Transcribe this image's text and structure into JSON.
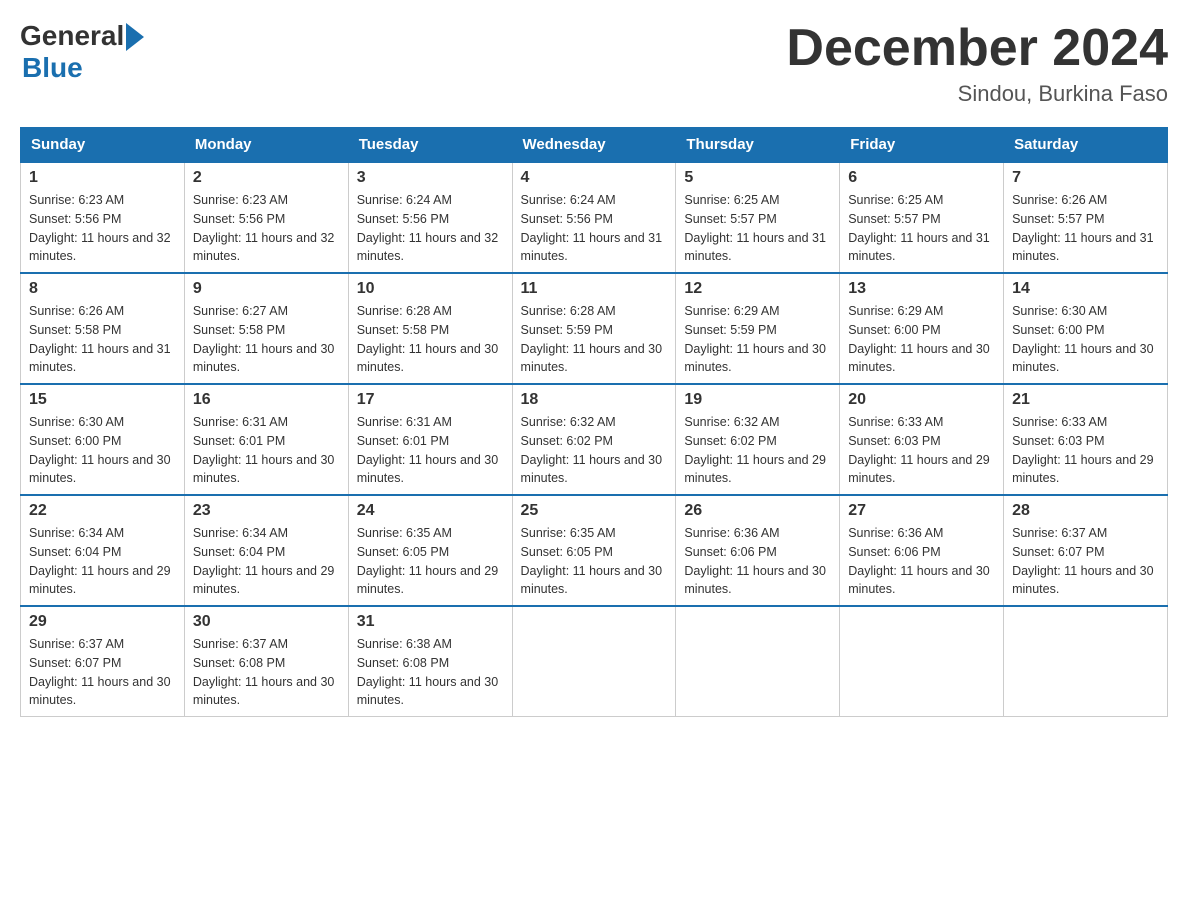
{
  "logo": {
    "general": "General",
    "blue": "Blue"
  },
  "title": {
    "month_year": "December 2024",
    "location": "Sindou, Burkina Faso"
  },
  "days_of_week": [
    "Sunday",
    "Monday",
    "Tuesday",
    "Wednesday",
    "Thursday",
    "Friday",
    "Saturday"
  ],
  "weeks": [
    [
      {
        "day": "1",
        "sunrise": "6:23 AM",
        "sunset": "5:56 PM",
        "daylight": "11 hours and 32 minutes."
      },
      {
        "day": "2",
        "sunrise": "6:23 AM",
        "sunset": "5:56 PM",
        "daylight": "11 hours and 32 minutes."
      },
      {
        "day": "3",
        "sunrise": "6:24 AM",
        "sunset": "5:56 PM",
        "daylight": "11 hours and 32 minutes."
      },
      {
        "day": "4",
        "sunrise": "6:24 AM",
        "sunset": "5:56 PM",
        "daylight": "11 hours and 31 minutes."
      },
      {
        "day": "5",
        "sunrise": "6:25 AM",
        "sunset": "5:57 PM",
        "daylight": "11 hours and 31 minutes."
      },
      {
        "day": "6",
        "sunrise": "6:25 AM",
        "sunset": "5:57 PM",
        "daylight": "11 hours and 31 minutes."
      },
      {
        "day": "7",
        "sunrise": "6:26 AM",
        "sunset": "5:57 PM",
        "daylight": "11 hours and 31 minutes."
      }
    ],
    [
      {
        "day": "8",
        "sunrise": "6:26 AM",
        "sunset": "5:58 PM",
        "daylight": "11 hours and 31 minutes."
      },
      {
        "day": "9",
        "sunrise": "6:27 AM",
        "sunset": "5:58 PM",
        "daylight": "11 hours and 30 minutes."
      },
      {
        "day": "10",
        "sunrise": "6:28 AM",
        "sunset": "5:58 PM",
        "daylight": "11 hours and 30 minutes."
      },
      {
        "day": "11",
        "sunrise": "6:28 AM",
        "sunset": "5:59 PM",
        "daylight": "11 hours and 30 minutes."
      },
      {
        "day": "12",
        "sunrise": "6:29 AM",
        "sunset": "5:59 PM",
        "daylight": "11 hours and 30 minutes."
      },
      {
        "day": "13",
        "sunrise": "6:29 AM",
        "sunset": "6:00 PM",
        "daylight": "11 hours and 30 minutes."
      },
      {
        "day": "14",
        "sunrise": "6:30 AM",
        "sunset": "6:00 PM",
        "daylight": "11 hours and 30 minutes."
      }
    ],
    [
      {
        "day": "15",
        "sunrise": "6:30 AM",
        "sunset": "6:00 PM",
        "daylight": "11 hours and 30 minutes."
      },
      {
        "day": "16",
        "sunrise": "6:31 AM",
        "sunset": "6:01 PM",
        "daylight": "11 hours and 30 minutes."
      },
      {
        "day": "17",
        "sunrise": "6:31 AM",
        "sunset": "6:01 PM",
        "daylight": "11 hours and 30 minutes."
      },
      {
        "day": "18",
        "sunrise": "6:32 AM",
        "sunset": "6:02 PM",
        "daylight": "11 hours and 30 minutes."
      },
      {
        "day": "19",
        "sunrise": "6:32 AM",
        "sunset": "6:02 PM",
        "daylight": "11 hours and 29 minutes."
      },
      {
        "day": "20",
        "sunrise": "6:33 AM",
        "sunset": "6:03 PM",
        "daylight": "11 hours and 29 minutes."
      },
      {
        "day": "21",
        "sunrise": "6:33 AM",
        "sunset": "6:03 PM",
        "daylight": "11 hours and 29 minutes."
      }
    ],
    [
      {
        "day": "22",
        "sunrise": "6:34 AM",
        "sunset": "6:04 PM",
        "daylight": "11 hours and 29 minutes."
      },
      {
        "day": "23",
        "sunrise": "6:34 AM",
        "sunset": "6:04 PM",
        "daylight": "11 hours and 29 minutes."
      },
      {
        "day": "24",
        "sunrise": "6:35 AM",
        "sunset": "6:05 PM",
        "daylight": "11 hours and 29 minutes."
      },
      {
        "day": "25",
        "sunrise": "6:35 AM",
        "sunset": "6:05 PM",
        "daylight": "11 hours and 30 minutes."
      },
      {
        "day": "26",
        "sunrise": "6:36 AM",
        "sunset": "6:06 PM",
        "daylight": "11 hours and 30 minutes."
      },
      {
        "day": "27",
        "sunrise": "6:36 AM",
        "sunset": "6:06 PM",
        "daylight": "11 hours and 30 minutes."
      },
      {
        "day": "28",
        "sunrise": "6:37 AM",
        "sunset": "6:07 PM",
        "daylight": "11 hours and 30 minutes."
      }
    ],
    [
      {
        "day": "29",
        "sunrise": "6:37 AM",
        "sunset": "6:07 PM",
        "daylight": "11 hours and 30 minutes."
      },
      {
        "day": "30",
        "sunrise": "6:37 AM",
        "sunset": "6:08 PM",
        "daylight": "11 hours and 30 minutes."
      },
      {
        "day": "31",
        "sunrise": "6:38 AM",
        "sunset": "6:08 PM",
        "daylight": "11 hours and 30 minutes."
      },
      null,
      null,
      null,
      null
    ]
  ],
  "labels": {
    "sunrise": "Sunrise: ",
    "sunset": "Sunset: ",
    "daylight": "Daylight: "
  }
}
